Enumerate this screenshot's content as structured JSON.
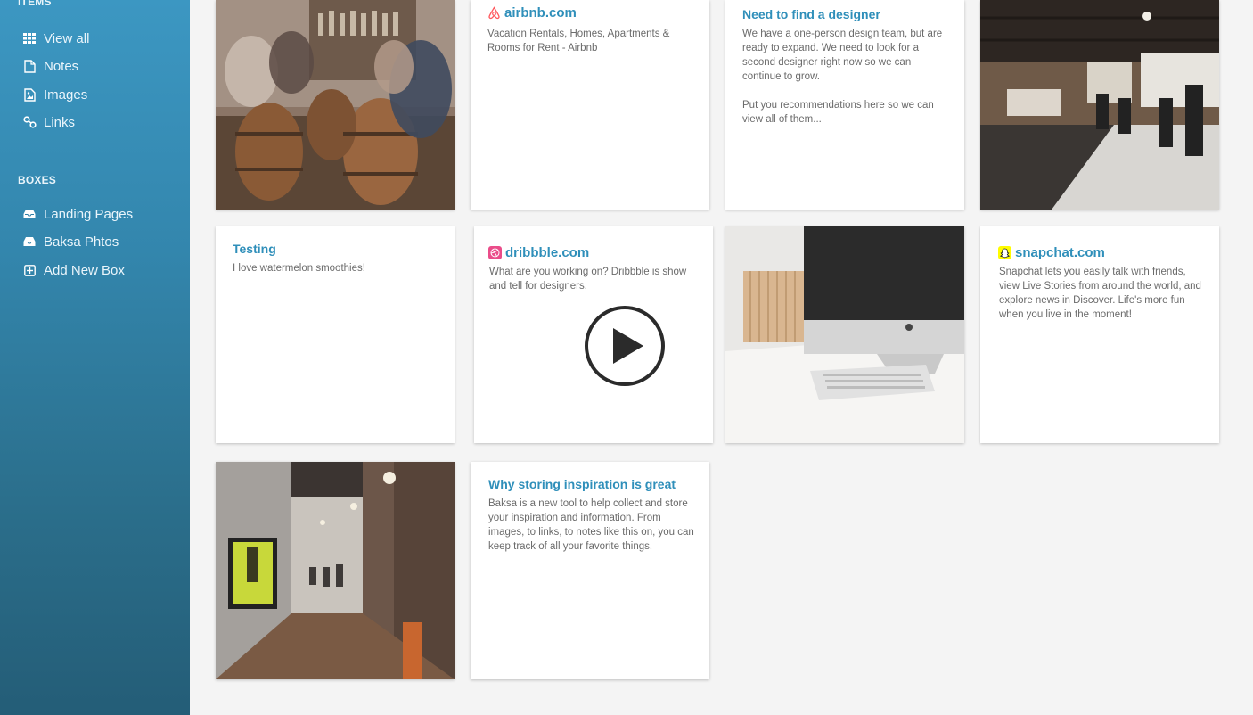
{
  "sidebar": {
    "items_heading": "ITEMS",
    "items": [
      {
        "label": "View all",
        "icon": "grid-icon"
      },
      {
        "label": "Notes",
        "icon": "note-icon"
      },
      {
        "label": "Images",
        "icon": "image-icon"
      },
      {
        "label": "Links",
        "icon": "link-icon"
      }
    ],
    "boxes_heading": "BOXES",
    "boxes": [
      {
        "label": "Landing Pages",
        "icon": "inbox-icon"
      },
      {
        "label": "Baksa Phtos",
        "icon": "inbox-icon"
      },
      {
        "label": "Add New Box",
        "icon": "plus-square-icon"
      }
    ]
  },
  "cards": {
    "airbnb": {
      "title": "airbnb.com",
      "body": "Vacation Rentals, Homes, Apartments & Rooms for Rent - Airbnb",
      "icon": "airbnb-logo-icon",
      "color": "#ff5a5f"
    },
    "designer": {
      "title": "Need to find a designer",
      "body": "We have a one-person design team, but are ready to expand. We need to look for a second designer right now so we can continue to grow.\n\nPut you recommendations here so we can view all of them..."
    },
    "testing": {
      "title": "Testing",
      "body": "I love watermelon smoothies!"
    },
    "dribbble": {
      "title": "dribbble.com",
      "body": "What are you working on? Dribbble is show and tell for designers.",
      "icon": "dribbble-logo-icon",
      "color": "#ea4c89"
    },
    "snapchat": {
      "title": "snapchat.com",
      "body": "Snapchat lets you easily talk with friends, view Live Stories from around the world, and explore news in Discover. Life's more fun when you live in the moment!",
      "icon": "snapchat-logo-icon",
      "color": "#fffc00"
    },
    "inspiration": {
      "title": "Why storing inspiration is great",
      "body": "Baksa is a new tool to help collect and store your inspiration and information. From images, to links, to notes like this on, you can keep track of all your favorite things."
    }
  },
  "colors": {
    "accent": "#2f8fba",
    "sidebar_top": "#3c97c2",
    "sidebar_bottom": "#245d77",
    "background": "#f4f4f4"
  }
}
